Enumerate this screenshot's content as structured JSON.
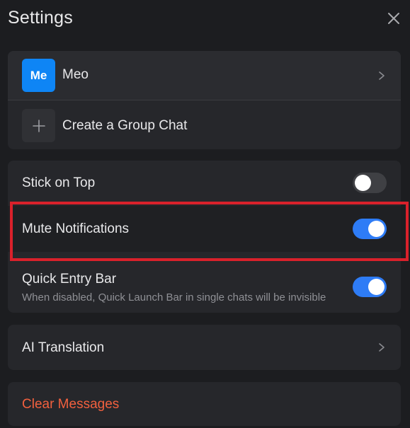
{
  "header": {
    "title": "Settings"
  },
  "profile": {
    "avatar_text": "Me",
    "user_name": "Meo",
    "create_group_label": "Create a Group Chat"
  },
  "toggles": [
    {
      "label": "Stick on Top",
      "state": "off"
    },
    {
      "label": "Mute Notifications",
      "state": "on"
    },
    {
      "label": "Quick Entry Bar",
      "sublabel": "When disabled, Quick Launch Bar in single chats will be invisible",
      "state": "on"
    }
  ],
  "ai": {
    "label": "AI Translation"
  },
  "clear": {
    "label": "Clear Messages"
  },
  "colors": {
    "background": "#1c1d20",
    "card": "#26272b",
    "accent_blue": "#2e7cf6",
    "avatar_blue": "#0e85f5",
    "danger": "#f2603e",
    "highlight_red": "#d9212b"
  },
  "icons": [
    "close-icon",
    "chevron-right-icon",
    "plus-icon"
  ]
}
